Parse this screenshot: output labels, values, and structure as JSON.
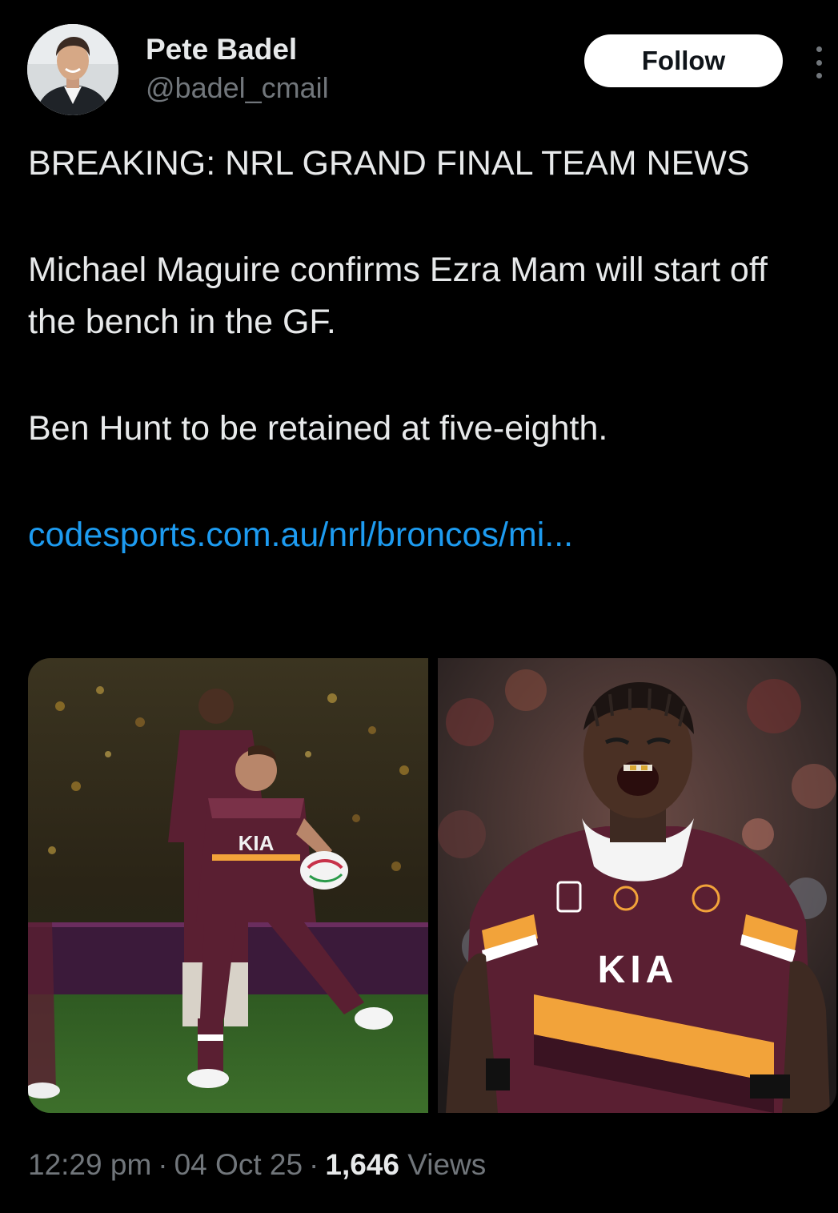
{
  "author": {
    "name": "Pete Badel",
    "handle": "@badel_cmail",
    "follow_label": "Follow"
  },
  "tweet": {
    "paragraphs": [
      "BREAKING: NRL GRAND FINAL TEAM NEWS",
      "Michael Maguire confirms Ezra Mam will start off the bench in the GF.",
      "Ben Hunt to be retained at five-eighth."
    ],
    "link_text": "codesports.com.au/nrl/broncos/mi..."
  },
  "media": [
    {
      "name": "photo-ben-hunt-passing",
      "jersey_text": "KIA"
    },
    {
      "name": "photo-ezra-mam-celebrating",
      "jersey_text": "KIA"
    }
  ],
  "meta": {
    "time": "12:29 pm",
    "date": "04 Oct 25",
    "views_count": "1,646",
    "views_label": "Views"
  },
  "colors": {
    "background": "#000000",
    "link": "#1d9bf0",
    "secondary_text": "#71767b",
    "primary_text": "#e7e9ea",
    "broncos_maroon": "#5a1f32",
    "broncos_gold": "#f2a33a"
  },
  "icons": {
    "more": "more-vertical-icon"
  }
}
